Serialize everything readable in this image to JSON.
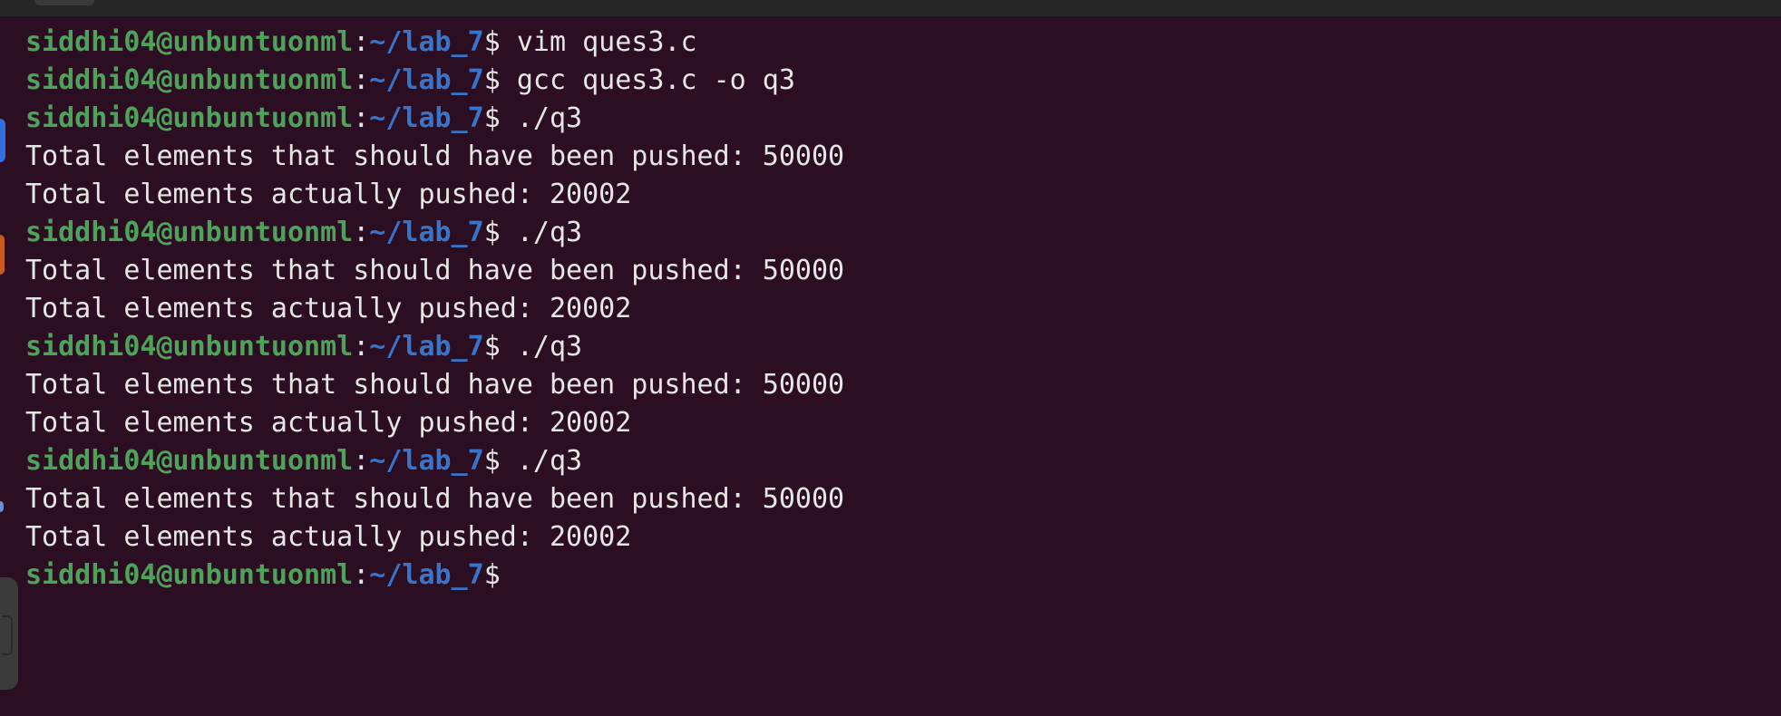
{
  "prompt": {
    "user": "siddhi04@unbuntuonml",
    "colon": ":",
    "path": "~/lab_7",
    "symbol": "$"
  },
  "lines": [
    {
      "type": "prompt",
      "command": " vim ques3.c"
    },
    {
      "type": "prompt",
      "command": " gcc ques3.c -o q3"
    },
    {
      "type": "prompt",
      "command": " ./q3"
    },
    {
      "type": "output",
      "text": "Total elements that should have been pushed: 50000"
    },
    {
      "type": "output",
      "text": "Total elements actually pushed: 20002"
    },
    {
      "type": "prompt",
      "command": " ./q3"
    },
    {
      "type": "output",
      "text": "Total elements that should have been pushed: 50000"
    },
    {
      "type": "output",
      "text": "Total elements actually pushed: 20002"
    },
    {
      "type": "prompt",
      "command": " ./q3"
    },
    {
      "type": "output",
      "text": "Total elements that should have been pushed: 50000"
    },
    {
      "type": "output",
      "text": "Total elements actually pushed: 20002"
    },
    {
      "type": "prompt",
      "command": " ./q3"
    },
    {
      "type": "output",
      "text": "Total elements that should have been pushed: 50000"
    },
    {
      "type": "output",
      "text": "Total elements actually pushed: 20002"
    },
    {
      "type": "prompt",
      "command": ""
    }
  ],
  "colors": {
    "background": "#2c0e22",
    "user": "#4ea35a",
    "path": "#3874c9",
    "text": "#e6e6e6"
  },
  "dock": {
    "icons": [
      "browser-icon",
      "files-icon",
      "app-icon",
      "terminal-icon"
    ]
  }
}
